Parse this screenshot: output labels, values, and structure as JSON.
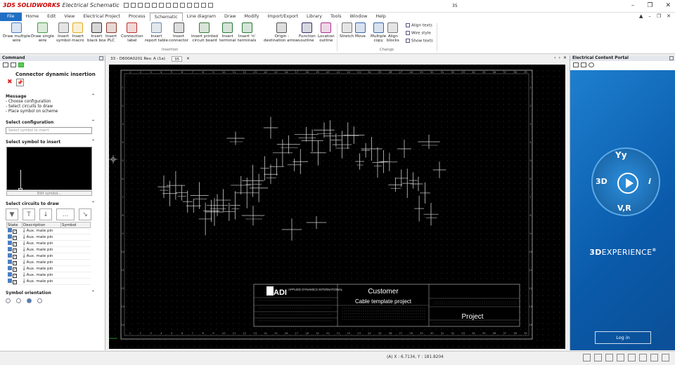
{
  "app": {
    "logo": "3DS",
    "brand": "SOLIDWORKS",
    "product": "Electrical Schematic",
    "doc_number": "35",
    "qat_icons": [
      "open-icon",
      "save-icon",
      "print-icon",
      "undo-icon",
      "redo-icon",
      "cut-icon",
      "copy-icon",
      "paste-icon",
      "zoom-icon",
      "pan-icon",
      "refresh-icon",
      "select-icon",
      "search-icon"
    ]
  },
  "menu": [
    "File",
    "Home",
    "Edit",
    "View",
    "Electrical Project",
    "Process",
    "Schematic",
    "Line diagram",
    "Draw",
    "Modify",
    "Import/Export",
    "Library",
    "Tools",
    "Window",
    "Help"
  ],
  "active_menu": "Schematic",
  "ribbon": {
    "insertion_buttons": [
      {
        "label": "Draw multiple\nwire",
        "icon": "multi-wire-icon",
        "color": "#4a7fc1"
      },
      {
        "label": "Draw single\nwire",
        "icon": "single-wire-icon",
        "color": "#4a9a4a"
      },
      {
        "label": "Insert\nsymbol",
        "icon": "symbol-icon",
        "color": "#777777"
      },
      {
        "label": "Insert\nmacro",
        "icon": "macro-star-icon",
        "color": "#e0b020"
      },
      {
        "label": "Insert\nblack box",
        "icon": "black-box-icon",
        "color": "#333333"
      },
      {
        "label": "Insert\nPLC",
        "icon": "plc-icon",
        "color": "#8a3a2a"
      },
      {
        "label": "Connection\nlabel",
        "icon": "connection-label-icon",
        "color": "#c03030"
      },
      {
        "label": "Insert\nreport table",
        "icon": "report-table-icon",
        "color": "#6a8aaa"
      },
      {
        "label": "Insert\nconnector",
        "icon": "connector-icon",
        "color": "#555555"
      },
      {
        "label": "Insert printed\ncircuit board",
        "icon": "pcb-icon",
        "color": "#3a7a3a"
      },
      {
        "label": "Insert\nterminal",
        "icon": "terminal-icon",
        "color": "#2a7a3a"
      },
      {
        "label": "Insert 'n'\nterminals",
        "icon": "n-terminals-icon",
        "color": "#2a7a3a"
      },
      {
        "label": "Origin -\ndestination arrows",
        "icon": "origin-destination-icon",
        "color": "#555555"
      },
      {
        "label": "Function\noutline",
        "icon": "function-outline-icon",
        "color": "#333366"
      },
      {
        "label": "Location\noutline",
        "icon": "location-outline-icon",
        "color": "#aa3388"
      }
    ],
    "changes_buttons": [
      {
        "label": "Stretch",
        "icon": "stretch-icon",
        "color": "#777777"
      },
      {
        "label": "Move",
        "icon": "move-icon",
        "color": "#3a6aaa"
      },
      {
        "label": "Multiple\ncopy",
        "icon": "multiple-copy-icon",
        "color": "#3a6aaa"
      },
      {
        "label": "Align\nblocks",
        "icon": "align-blocks-icon",
        "color": "#777777"
      }
    ],
    "small_buttons": [
      "Align texts",
      "Wire style",
      "Show texts"
    ],
    "group_insertion": "Insertion",
    "group_changes": "Change"
  },
  "command_panel": {
    "header": "Command",
    "title": "Connector dynamic insertion",
    "message_header": "Message",
    "messages": [
      "- Choose configuration",
      "- Select circuits to draw",
      "- Place symbol on scheme"
    ],
    "config_header": "Select configuration",
    "config_value": "Select symbol to insert",
    "symbol_header": "Select symbol to insert",
    "symbol_button": "Edit symbol...",
    "circuits_header": "Select circuits to draw",
    "columns": [
      "State",
      "Description",
      "Symbol"
    ],
    "rows": [
      "Aux. male pin",
      "Aux. male pin",
      "Aux. male pin",
      "Aux. male pin",
      "Aux. male pin",
      "Aux. male pin",
      "Aux. male pin",
      "Aux. male pin",
      "Aux. male pin"
    ],
    "orientation_header": "Symbol orientation"
  },
  "doc_tabs": [
    "33 - D600A0201 Rev. A (1a)",
    "35"
  ],
  "title_block": {
    "company_short": "ADI",
    "company_full": "APPLIED DYNAMICS INTERNATIONAL",
    "customer": "Customer",
    "project_title": "Cable template project",
    "project": "Project"
  },
  "axis_numbers": [
    "1",
    "2",
    "3",
    "4",
    "5",
    "6",
    "7",
    "8",
    "9",
    "10",
    "11",
    "12",
    "13",
    "14",
    "15",
    "16",
    "17",
    "18",
    "19",
    "20",
    "21",
    "22",
    "23",
    "24",
    "25",
    "26",
    "27",
    "28",
    "29",
    "30",
    "31",
    "32",
    "33",
    "34",
    "35",
    "36",
    "37",
    "38",
    "39"
  ],
  "row_numbers": [
    "1",
    "2",
    "3",
    "4",
    "5",
    "6",
    "7",
    "8",
    "9",
    "10",
    "11",
    "12",
    "13",
    "14"
  ],
  "portal": {
    "header": "Electrical Content Portal",
    "compass_3d": "3D",
    "compass_i": "i",
    "compass_vr": "V,R",
    "brand_bold": "3D",
    "brand_light": "EXPERIENCE",
    "login": "Log in"
  },
  "status": {
    "coords": "(A) X : 6.7134, Y : 181.8204"
  }
}
